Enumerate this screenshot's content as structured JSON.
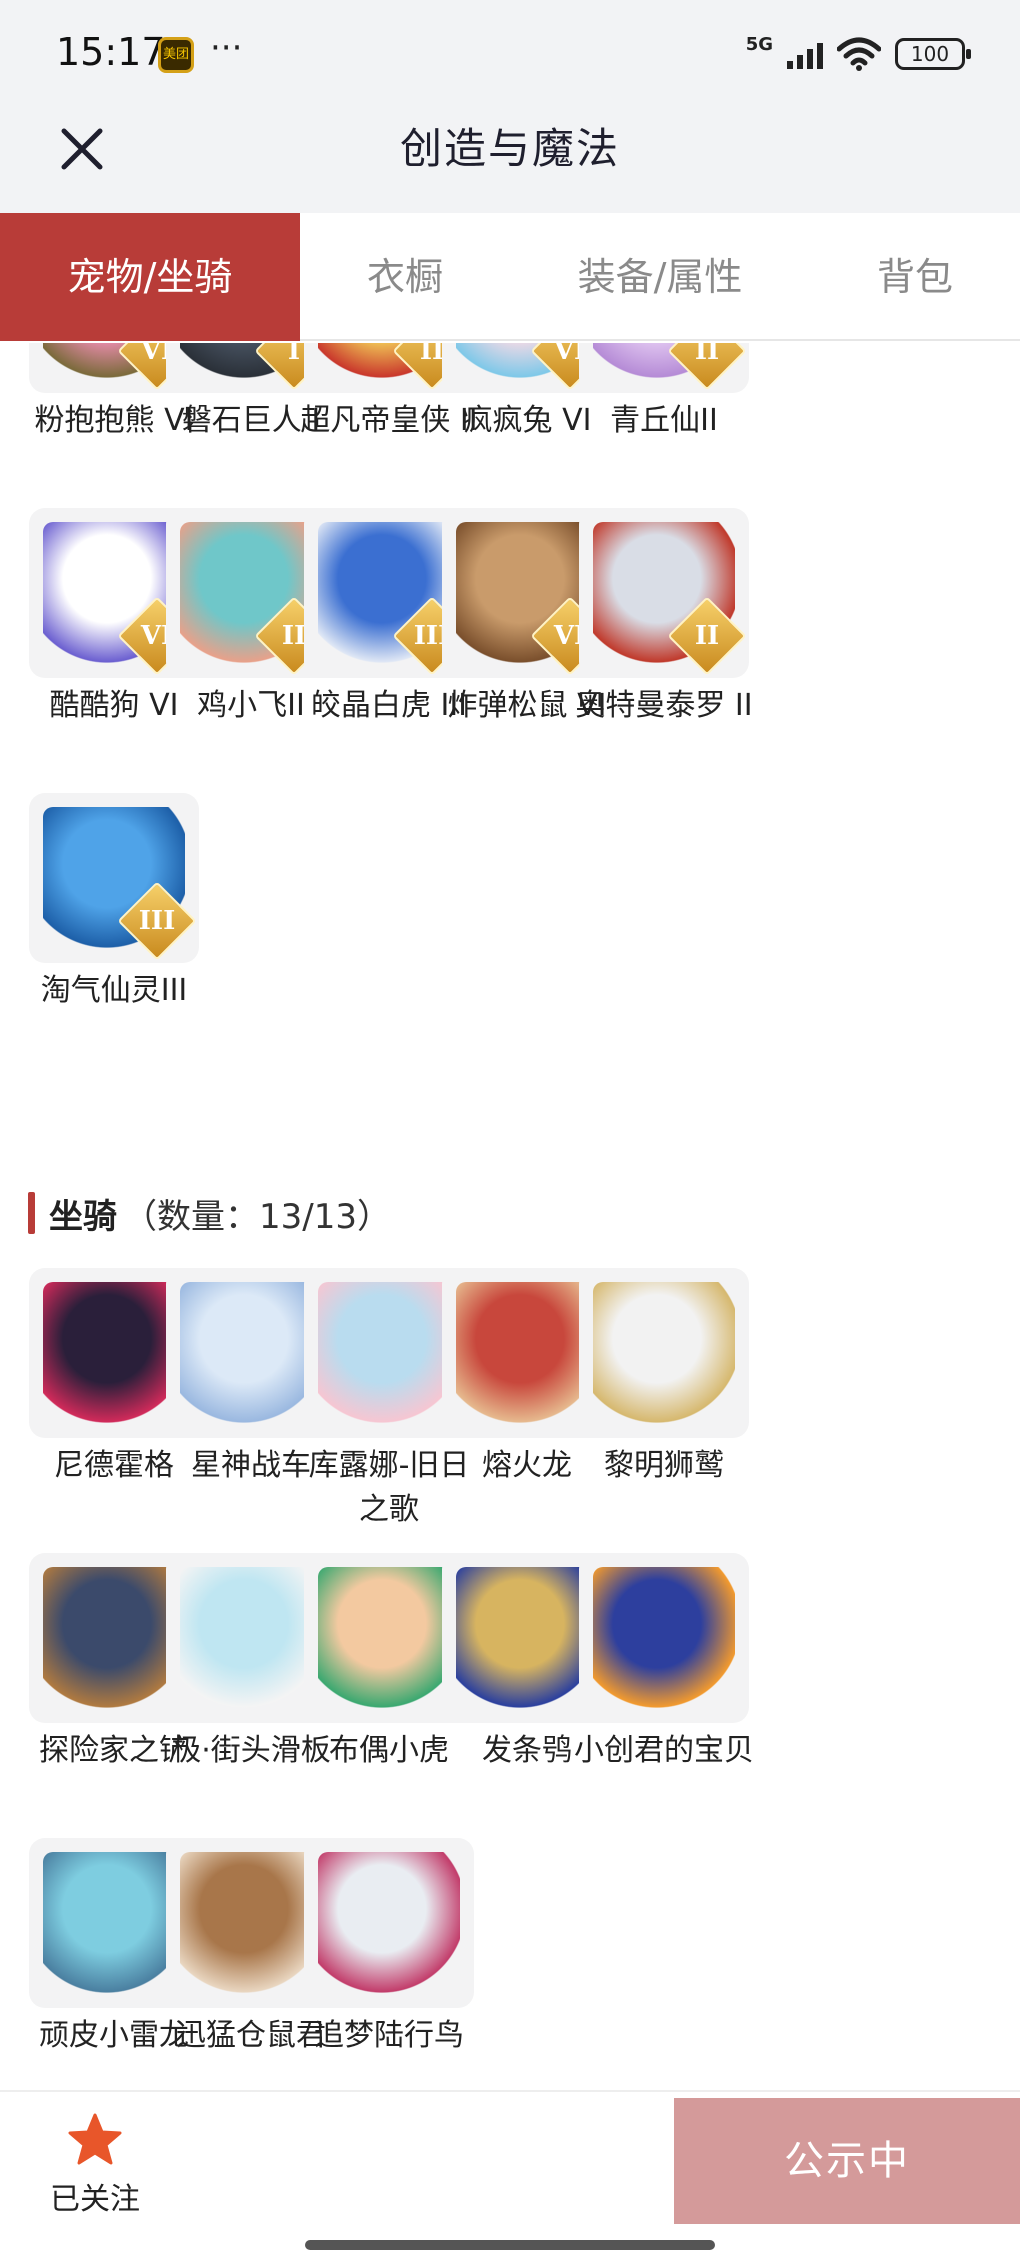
{
  "status_bar": {
    "time": "15:17",
    "app_badge": "美团",
    "more": "···",
    "network": "5G",
    "battery": "100"
  },
  "nav": {
    "title": "创造与魔法"
  },
  "tabs": [
    {
      "label": "宠物/坐骑",
      "active": true
    },
    {
      "label": "衣橱",
      "active": false
    },
    {
      "label": "装备/属性",
      "active": false
    },
    {
      "label": "背包",
      "active": false
    }
  ],
  "pets": [
    {
      "name": "粉抱抱熊 VI",
      "tier": "VI"
    },
    {
      "name": "磐石巨人 I",
      "tier": "I"
    },
    {
      "name": "超凡帝皇侠 II",
      "tier": "II"
    },
    {
      "name": "疯疯兔 VI",
      "tier": "VI"
    },
    {
      "name": "青丘仙II",
      "tier": "II"
    },
    {
      "name": "酷酷狗 VI",
      "tier": "VI"
    },
    {
      "name": "鸡小飞II",
      "tier": "II"
    },
    {
      "name": "皎晶白虎 III",
      "tier": "III"
    },
    {
      "name": "炸弹松鼠 VI",
      "tier": "VI"
    },
    {
      "name": "奥特曼泰罗 II",
      "tier": "II"
    },
    {
      "name": "淘气仙灵III",
      "tier": "III"
    }
  ],
  "mounts_section": {
    "title": "坐骑",
    "count": "（数量：13/13）"
  },
  "mounts": [
    {
      "name": "尼德霍格"
    },
    {
      "name": "星神战车"
    },
    {
      "name": "库露娜-旧日之歌"
    },
    {
      "name": "熔火龙"
    },
    {
      "name": "黎明狮鹫"
    },
    {
      "name": "探险家之铲"
    },
    {
      "name": "极·街头滑板"
    },
    {
      "name": "布偶小虎"
    },
    {
      "name": "发条鸮"
    },
    {
      "name": "小创君的宝贝"
    },
    {
      "name": "顽皮小雷龙"
    },
    {
      "name": "迅猛仓鼠君"
    },
    {
      "name": "追梦陆行鸟"
    }
  ],
  "bottom": {
    "follow_label": "已关注",
    "publish_label": "公示中"
  },
  "colors": {
    "accent": "#b83c38",
    "publish_bg": "#d49a9a",
    "star": "#e8562a"
  }
}
